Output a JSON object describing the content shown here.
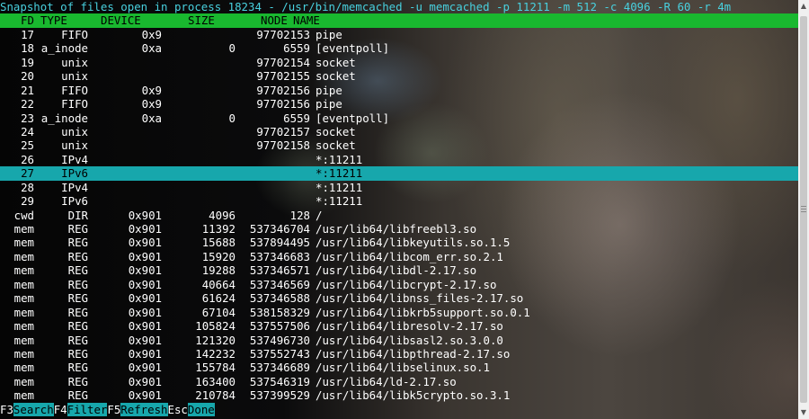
{
  "title": "Snapshot of files open in process 18234 - /usr/bin/memcached -u memcached -p 11211 -m 512 -c 4096 -R 60 -r 4m",
  "headers": {
    "fd": "FD",
    "type": "TYPE",
    "device": "DEVICE",
    "size": "SIZE",
    "node": "NODE",
    "name": "NAME"
  },
  "selected_row_index": 10,
  "rows": [
    {
      "fd": "17",
      "type": "FIFO",
      "device": "0x9",
      "size": "",
      "node": "97702153",
      "name": "pipe"
    },
    {
      "fd": "18",
      "type": "a_inode",
      "device": "0xa",
      "size": "0",
      "node": "6559",
      "name": "[eventpoll]"
    },
    {
      "fd": "19",
      "type": "unix",
      "device": "",
      "size": "",
      "node": "97702154",
      "name": "socket"
    },
    {
      "fd": "20",
      "type": "unix",
      "device": "",
      "size": "",
      "node": "97702155",
      "name": "socket"
    },
    {
      "fd": "21",
      "type": "FIFO",
      "device": "0x9",
      "size": "",
      "node": "97702156",
      "name": "pipe"
    },
    {
      "fd": "22",
      "type": "FIFO",
      "device": "0x9",
      "size": "",
      "node": "97702156",
      "name": "pipe"
    },
    {
      "fd": "23",
      "type": "a_inode",
      "device": "0xa",
      "size": "0",
      "node": "6559",
      "name": "[eventpoll]"
    },
    {
      "fd": "24",
      "type": "unix",
      "device": "",
      "size": "",
      "node": "97702157",
      "name": "socket"
    },
    {
      "fd": "25",
      "type": "unix",
      "device": "",
      "size": "",
      "node": "97702158",
      "name": "socket"
    },
    {
      "fd": "26",
      "type": "IPv4",
      "device": "",
      "size": "",
      "node": "",
      "name": "*:11211"
    },
    {
      "fd": "27",
      "type": "IPv6",
      "device": "",
      "size": "",
      "node": "",
      "name": "*:11211"
    },
    {
      "fd": "28",
      "type": "IPv4",
      "device": "",
      "size": "",
      "node": "",
      "name": "*:11211"
    },
    {
      "fd": "29",
      "type": "IPv6",
      "device": "",
      "size": "",
      "node": "",
      "name": "*:11211"
    },
    {
      "fd": "cwd",
      "type": "DIR",
      "device": "0x901",
      "size": "4096",
      "node": "128",
      "name": "/"
    },
    {
      "fd": "mem",
      "type": "REG",
      "device": "0x901",
      "size": "11392",
      "node": "537346704",
      "name": "/usr/lib64/libfreebl3.so"
    },
    {
      "fd": "mem",
      "type": "REG",
      "device": "0x901",
      "size": "15688",
      "node": "537894495",
      "name": "/usr/lib64/libkeyutils.so.1.5"
    },
    {
      "fd": "mem",
      "type": "REG",
      "device": "0x901",
      "size": "15920",
      "node": "537346683",
      "name": "/usr/lib64/libcom_err.so.2.1"
    },
    {
      "fd": "mem",
      "type": "REG",
      "device": "0x901",
      "size": "19288",
      "node": "537346571",
      "name": "/usr/lib64/libdl-2.17.so"
    },
    {
      "fd": "mem",
      "type": "REG",
      "device": "0x901",
      "size": "40664",
      "node": "537346569",
      "name": "/usr/lib64/libcrypt-2.17.so"
    },
    {
      "fd": "mem",
      "type": "REG",
      "device": "0x901",
      "size": "61624",
      "node": "537346588",
      "name": "/usr/lib64/libnss_files-2.17.so"
    },
    {
      "fd": "mem",
      "type": "REG",
      "device": "0x901",
      "size": "67104",
      "node": "538158329",
      "name": "/usr/lib64/libkrb5support.so.0.1"
    },
    {
      "fd": "mem",
      "type": "REG",
      "device": "0x901",
      "size": "105824",
      "node": "537557506",
      "name": "/usr/lib64/libresolv-2.17.so"
    },
    {
      "fd": "mem",
      "type": "REG",
      "device": "0x901",
      "size": "121320",
      "node": "537496730",
      "name": "/usr/lib64/libsasl2.so.3.0.0"
    },
    {
      "fd": "mem",
      "type": "REG",
      "device": "0x901",
      "size": "142232",
      "node": "537552743",
      "name": "/usr/lib64/libpthread-2.17.so"
    },
    {
      "fd": "mem",
      "type": "REG",
      "device": "0x901",
      "size": "155784",
      "node": "537346689",
      "name": "/usr/lib64/libselinux.so.1"
    },
    {
      "fd": "mem",
      "type": "REG",
      "device": "0x901",
      "size": "163400",
      "node": "537546319",
      "name": "/usr/lib64/ld-2.17.so"
    },
    {
      "fd": "mem",
      "type": "REG",
      "device": "0x901",
      "size": "210784",
      "node": "537399529",
      "name": "/usr/lib64/libk5crypto.so.3.1"
    }
  ],
  "footer": [
    {
      "key": "F3",
      "label": "Search"
    },
    {
      "key": "F4",
      "label": "Filter"
    },
    {
      "key": "F5",
      "label": "Refresh"
    },
    {
      "key": "Esc",
      "label": "Done"
    }
  ],
  "icons": {
    "scroll_up": "scroll-up-arrow-icon",
    "scroll_down": "scroll-down-arrow-icon"
  },
  "colors": {
    "header_bg": "#19b82f",
    "selection_bg": "#17a7ac",
    "title_fg": "#48d1df",
    "footer_label_bg": "#17a7ac"
  }
}
